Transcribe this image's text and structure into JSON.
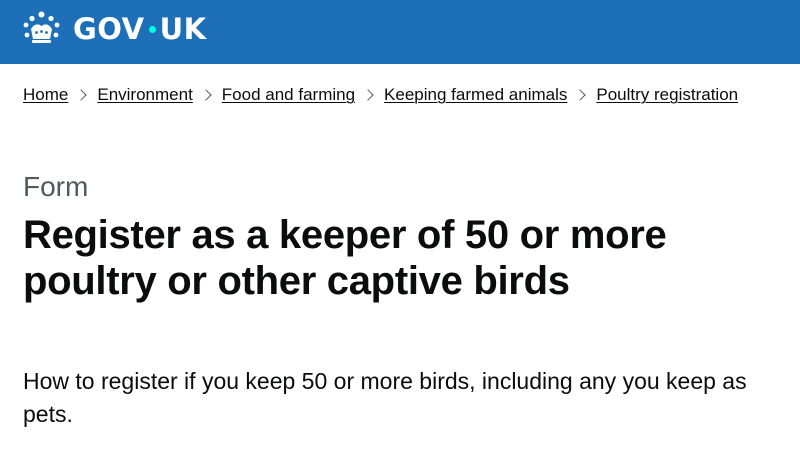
{
  "header": {
    "logo_text_left": "GOV",
    "logo_text_right": "UK",
    "logo_icon": "crown-icon",
    "background_color": "#1d70b8",
    "dot_color": "#00ffe0"
  },
  "breadcrumbs": [
    {
      "label": "Home"
    },
    {
      "label": "Environment"
    },
    {
      "label": "Food and farming"
    },
    {
      "label": "Keeping farmed animals"
    },
    {
      "label": "Poultry registration"
    }
  ],
  "main": {
    "caption": "Form",
    "title": "Register as a keeper of 50 or more poultry or other captive birds",
    "lead": "How to register if you keep 50 or more birds, including any you keep as pets."
  }
}
